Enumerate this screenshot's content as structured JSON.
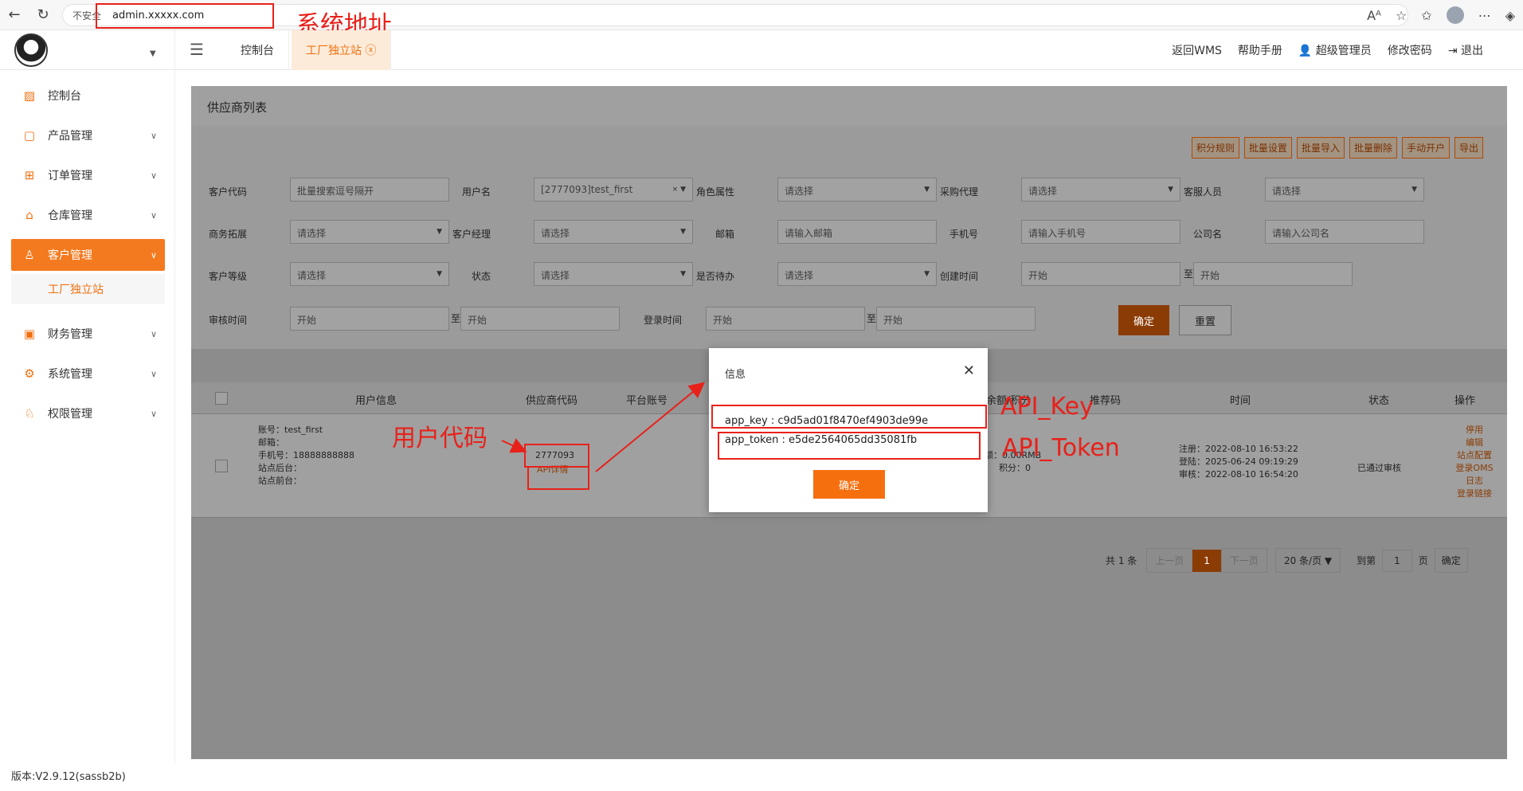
{
  "browser": {
    "security_label": "不安全",
    "url": "admin.xxxxx.com"
  },
  "annotations": {
    "system_address": "系统地址",
    "user_code": "用户代码",
    "api_key": "API_Key",
    "api_token": "API_Token"
  },
  "header": {
    "tabs": [
      {
        "label": "控制台"
      },
      {
        "label": "工厂独立站 ⓧ"
      }
    ],
    "right": {
      "back_wms": "返回WMS",
      "help": "帮助手册",
      "user": "超级管理员",
      "change_password": "修改密码",
      "logout": "退出"
    }
  },
  "sidebar": {
    "items": [
      {
        "label": "控制台"
      },
      {
        "label": "产品管理"
      },
      {
        "label": "订单管理"
      },
      {
        "label": "仓库管理"
      },
      {
        "label": "客户管理"
      },
      {
        "label": "财务管理"
      },
      {
        "label": "系统管理"
      },
      {
        "label": "权限管理"
      }
    ],
    "sub_item": "工厂独立站",
    "version": "版本:V2.9.12(sassb2b)"
  },
  "main": {
    "title": "供应商列表",
    "actions": [
      "积分规则",
      "批量设置",
      "批量导入",
      "批量删除",
      "手动开户",
      "导出"
    ],
    "filters": {
      "customer_code": {
        "label": "客户代码",
        "placeholder": "批量搜索逗号隔开"
      },
      "username": {
        "label": "用户名",
        "value": "[2777093]test_first"
      },
      "role": {
        "label": "角色属性",
        "placeholder": "请选择"
      },
      "purchase_agent": {
        "label": "采购代理",
        "placeholder": "请选择"
      },
      "service": {
        "label": "客服人员",
        "placeholder": "请选择"
      },
      "bd": {
        "label": "商务拓展",
        "placeholder": "请选择"
      },
      "manager": {
        "label": "客户经理",
        "placeholder": "请选择"
      },
      "email": {
        "label": "邮箱",
        "placeholder": "请输入邮箱"
      },
      "phone": {
        "label": "手机号",
        "placeholder": "请输入手机号"
      },
      "company": {
        "label": "公司名",
        "placeholder": "请输入公司名"
      },
      "level": {
        "label": "客户等级",
        "placeholder": "请选择"
      },
      "status": {
        "label": "状态",
        "placeholder": "请选择"
      },
      "pending": {
        "label": "是否待办",
        "placeholder": "请选择"
      },
      "created": {
        "label": "创建时间",
        "start": "开始",
        "sep": "至",
        "end": "开始"
      },
      "review": {
        "label": "审核时间",
        "start": "开始",
        "sep": "至",
        "end": "开始"
      },
      "login": {
        "label": "登录时间",
        "start": "开始",
        "sep": "至",
        "end": "开始"
      }
    },
    "confirm_label": "确定",
    "reset_label": "重置",
    "table": {
      "headers": [
        "用户信息",
        "供应商代码",
        "平台账号",
        "余额/积分",
        "推荐码",
        "时间",
        "状态",
        "操作"
      ],
      "row": {
        "account": "账号：test_first",
        "email": "邮箱：",
        "phone": "手机号：18888888888",
        "backend": "站点后台：",
        "frontend": "站点前台：",
        "supplier_code": "2777093",
        "api_detail": "API详情",
        "balance": "额：0.00RMB",
        "points": "积分：0",
        "registered": "注册：2022-08-10 16:53:22",
        "logged_in": "登陆：2025-06-24 09:19:29",
        "reviewed": "审核：2022-08-10 16:54:20",
        "status": "已通过审核",
        "ops": [
          "停用",
          "编辑",
          "站点配置",
          "登录OMS",
          "日志",
          "登录链接"
        ]
      }
    },
    "pagination": {
      "total": "共 1 条",
      "prev": "上一页",
      "current": "1",
      "next": "下一页",
      "page_size": "20 条/页",
      "goto": "到第",
      "goto_value": "1",
      "page_unit": "页",
      "confirm": "确定"
    }
  },
  "modal": {
    "title": "信息",
    "app_key": "app_key : c9d5ad01f8470ef4903de99e",
    "app_token": "app_token : e5de2564065dd35081fb",
    "ok_label": "确定"
  }
}
